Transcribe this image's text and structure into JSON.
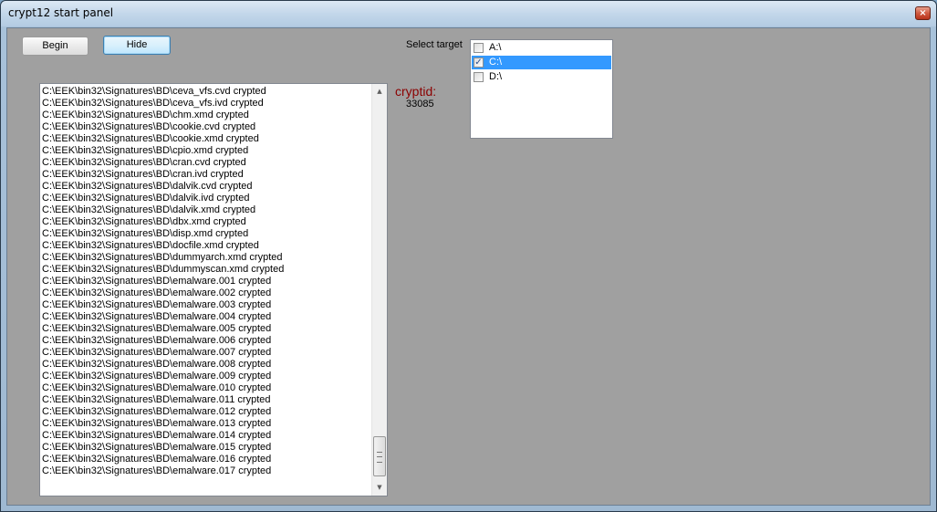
{
  "window": {
    "title": "crypt12 start panel",
    "close_glyph": "×"
  },
  "buttons": {
    "begin": "Begin",
    "hide": "Hide"
  },
  "cryptid": {
    "label": "cryptid:",
    "value": "33085"
  },
  "target": {
    "label": "Select target",
    "drives": [
      {
        "label": "A:\\",
        "checked": false,
        "selected": false
      },
      {
        "label": "C:\\",
        "checked": true,
        "selected": true
      },
      {
        "label": "D:\\",
        "checked": false,
        "selected": false
      }
    ]
  },
  "log": {
    "lines": [
      "C:\\EEK\\bin32\\Signatures\\BD\\ceva_vfs.cvd crypted",
      "C:\\EEK\\bin32\\Signatures\\BD\\ceva_vfs.ivd crypted",
      "C:\\EEK\\bin32\\Signatures\\BD\\chm.xmd crypted",
      "C:\\EEK\\bin32\\Signatures\\BD\\cookie.cvd crypted",
      "C:\\EEK\\bin32\\Signatures\\BD\\cookie.xmd crypted",
      "C:\\EEK\\bin32\\Signatures\\BD\\cpio.xmd crypted",
      "C:\\EEK\\bin32\\Signatures\\BD\\cran.cvd crypted",
      "C:\\EEK\\bin32\\Signatures\\BD\\cran.ivd crypted",
      "C:\\EEK\\bin32\\Signatures\\BD\\dalvik.cvd crypted",
      "C:\\EEK\\bin32\\Signatures\\BD\\dalvik.ivd crypted",
      "C:\\EEK\\bin32\\Signatures\\BD\\dalvik.xmd crypted",
      "C:\\EEK\\bin32\\Signatures\\BD\\dbx.xmd crypted",
      "C:\\EEK\\bin32\\Signatures\\BD\\disp.xmd crypted",
      "C:\\EEK\\bin32\\Signatures\\BD\\docfile.xmd crypted",
      "C:\\EEK\\bin32\\Signatures\\BD\\dummyarch.xmd crypted",
      "C:\\EEK\\bin32\\Signatures\\BD\\dummyscan.xmd crypted",
      "C:\\EEK\\bin32\\Signatures\\BD\\emalware.001 crypted",
      "C:\\EEK\\bin32\\Signatures\\BD\\emalware.002 crypted",
      "C:\\EEK\\bin32\\Signatures\\BD\\emalware.003 crypted",
      "C:\\EEK\\bin32\\Signatures\\BD\\emalware.004 crypted",
      "C:\\EEK\\bin32\\Signatures\\BD\\emalware.005 crypted",
      "C:\\EEK\\bin32\\Signatures\\BD\\emalware.006 crypted",
      "C:\\EEK\\bin32\\Signatures\\BD\\emalware.007 crypted",
      "C:\\EEK\\bin32\\Signatures\\BD\\emalware.008 crypted",
      "C:\\EEK\\bin32\\Signatures\\BD\\emalware.009 crypted",
      "C:\\EEK\\bin32\\Signatures\\BD\\emalware.010 crypted",
      "C:\\EEK\\bin32\\Signatures\\BD\\emalware.011 crypted",
      "C:\\EEK\\bin32\\Signatures\\BD\\emalware.012 crypted",
      "C:\\EEK\\bin32\\Signatures\\BD\\emalware.013 crypted",
      "C:\\EEK\\bin32\\Signatures\\BD\\emalware.014 crypted",
      "C:\\EEK\\bin32\\Signatures\\BD\\emalware.015 crypted",
      "C:\\EEK\\bin32\\Signatures\\BD\\emalware.016 crypted",
      "C:\\EEK\\bin32\\Signatures\\BD\\emalware.017 crypted"
    ]
  },
  "icons": {
    "close": "close-icon",
    "scroll_up": "scroll-up-arrow-icon",
    "scroll_down": "scroll-down-arrow-icon",
    "checkmark": "checkmark-icon"
  }
}
